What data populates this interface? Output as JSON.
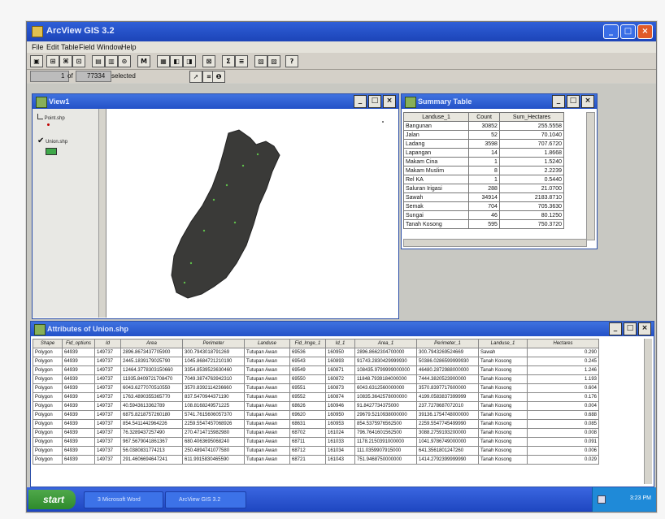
{
  "app": {
    "title": "ArcView GIS 3.2",
    "min": "_",
    "max": "□",
    "close": "×"
  },
  "menu": [
    "File",
    "Edit",
    "Table",
    "Field",
    "Window",
    "Help"
  ],
  "toolbar_icons": [
    "save-icon",
    "open-icon",
    "tool-a-icon",
    "tool-b-icon",
    "tool-c-icon",
    "tool-d-icon",
    "tool-e-icon",
    "zoom-icon",
    "tool-f-icon",
    "sigma-icon",
    "sort-icon",
    "query-icon",
    "help-icon"
  ],
  "selection": {
    "count": "1",
    "of": "of",
    "total": "77334",
    "label": "selected"
  },
  "view": {
    "title": "View1",
    "legend": [
      {
        "label": "Point.shp",
        "color": "#c00000",
        "checked": false
      },
      {
        "label": "Union.shp",
        "color": "#3fa84a",
        "checked": true
      }
    ]
  },
  "stats": {
    "title": "Summary Table",
    "headers": [
      "Landuse_1",
      "Count",
      "Sum_Hectares"
    ],
    "rows": [
      [
        "Bangunan",
        "30852",
        "255.5558"
      ],
      [
        "Jalan",
        "52",
        "70.1040"
      ],
      [
        "Ladang",
        "3598",
        "707.6720"
      ],
      [
        "Lapangan",
        "14",
        "1.8668"
      ],
      [
        "Makam Cina",
        "1",
        "1.5240"
      ],
      [
        "Makam Muslim",
        "8",
        "2.2239"
      ],
      [
        "Rel KA",
        "1",
        "0.5440"
      ],
      [
        "Saluran Irigasi",
        "288",
        "21.0700"
      ],
      [
        "Sawah",
        "34914",
        "2183.8710"
      ],
      [
        "Semak",
        "704",
        "705.3630"
      ],
      [
        "Sungai",
        "46",
        "80.1250"
      ],
      [
        "Tanah Kosong",
        "595",
        "750.3720"
      ]
    ]
  },
  "attr": {
    "title": "Attributes of Union.shp",
    "headers": [
      "Shape",
      "Fid_optiuns",
      "Id",
      "Area",
      "Perimeter",
      "Landuse",
      "Fid_Imge_1",
      "Id_1",
      "Area_1",
      "Perimeter_1",
      "Landuse_1",
      "Hectares"
    ],
    "rows": [
      [
        "Polygon",
        "64939",
        "149737",
        "2896.8673437705900",
        "300.7943018791269",
        "Tutupan Awan",
        "69536",
        "160950",
        "2896.8662304700000",
        "300.7943269524669",
        "Sawah",
        "0.290"
      ],
      [
        "Polygon",
        "64939",
        "149737",
        "2445.1839179025790",
        "1045.8684721210190",
        "Tutupan Awan",
        "69543",
        "160893",
        "91743.2830429999930",
        "50386.0286599999930",
        "Tanah Kosong",
        "0.245"
      ],
      [
        "Polygon",
        "64939",
        "149737",
        "12464.3778303150660",
        "3354.8539523630460",
        "Tutupan Awan",
        "69549",
        "160871",
        "108435.9799999000000",
        "46480.2872988000000",
        "Tanah Kosong",
        "1.246"
      ],
      [
        "Polygon",
        "64939",
        "149737",
        "11935.8409721708470",
        "7049.3874763942310",
        "Tutupan Awan",
        "69550",
        "160872",
        "11848.7939184000000",
        "7444.3820523900000",
        "Tanah Kosong",
        "1.193"
      ],
      [
        "Polygon",
        "64939",
        "149737",
        "6043.6277070510550",
        "3570.8392114236660",
        "Tutupan Awan",
        "69551",
        "160873",
        "6043.6312560000000",
        "3570.8397717600000",
        "Tanah Kosong",
        "0.604"
      ],
      [
        "Polygon",
        "64939",
        "149737",
        "1763.4890355365770",
        "837.5470944371190",
        "Tutupan Awan",
        "69552",
        "160874",
        "10835.3642578000000",
        "4199.0583837399999",
        "Tanah Kosong",
        "0.176"
      ],
      [
        "Polygon",
        "64939",
        "149737",
        "40.5943613362789",
        "108.8168249571225",
        "Tutupan Awan",
        "68626",
        "160946",
        "91.8427734375000",
        "237.7278687072010",
        "Tanah Kosong",
        "0.004"
      ],
      [
        "Polygon",
        "64939",
        "149737",
        "6875.8218757260180",
        "5741.7615606057370",
        "Tutupan Awan",
        "69620",
        "160950",
        "29679.5210938000000",
        "39136.1754748000000",
        "Tanah Kosong",
        "0.688"
      ],
      [
        "Polygon",
        "64939",
        "149737",
        "854.5411442964226",
        "2259.5547457068926",
        "Tutupan Awan",
        "68631",
        "160953",
        "854.5375976562500",
        "2259.5547745499990",
        "Tanah Kosong",
        "0.085"
      ],
      [
        "Polygon",
        "64939",
        "149737",
        "76.3289437257490",
        "270.4714715982980",
        "Tutupan Awan",
        "68702",
        "161024",
        "796.7641601562500",
        "3088.2759193200000",
        "Tanah Kosong",
        "0.008"
      ],
      [
        "Polygon",
        "64939",
        "149737",
        "967.5679041861367",
        "680.4063695068240",
        "Tutupan Awan",
        "68711",
        "161033",
        "1178.2150391000000",
        "1041.9786749000000",
        "Tanah Kosong",
        "0.091"
      ],
      [
        "Polygon",
        "64939",
        "149737",
        "56.0380831774213",
        "250.4894741077580",
        "Tutupan Awan",
        "68712",
        "161034",
        "111.0359907915000",
        "641.3561801247260",
        "Tanah Kosong",
        "0.006"
      ],
      [
        "Polygon",
        "64939",
        "149737",
        "291.4606694647241",
        "611.9915830465590",
        "Tutupan Awan",
        "68721",
        "161043",
        "751.9468750000000",
        "1414.2792399999990",
        "Tanah Kosong",
        "0.029"
      ]
    ]
  },
  "taskbar": {
    "start": "start",
    "tasks": [
      "3 Microsoft Word",
      "ArcView GIS 3.2"
    ],
    "clock": "3:23 PM"
  }
}
